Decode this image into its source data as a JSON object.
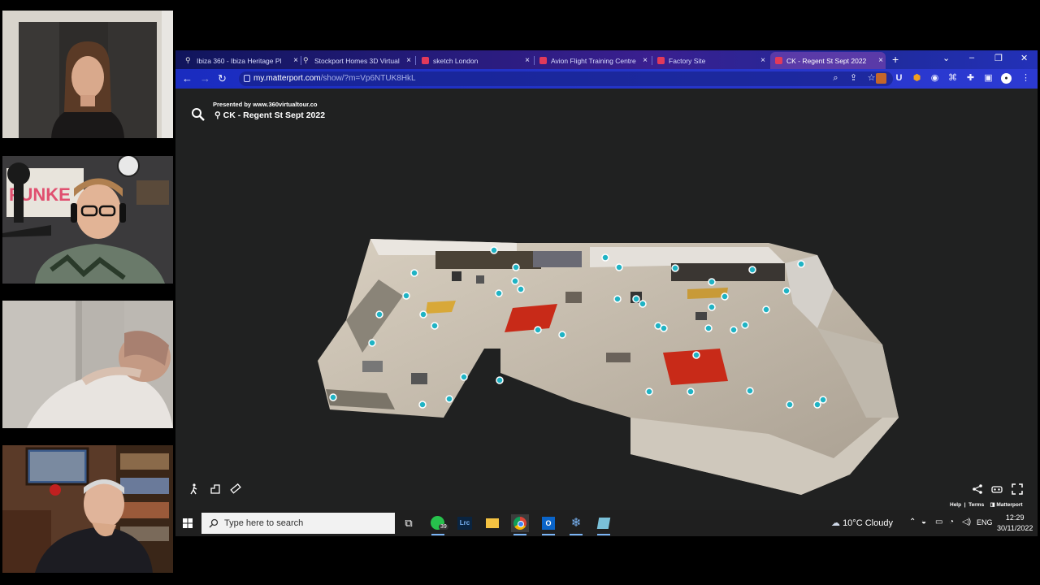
{
  "browser": {
    "tabs": [
      {
        "title": "Ibiza 360 - Ibiza Heritage Pl",
        "icon": "location-pin-icon",
        "active": false
      },
      {
        "title": "Stockport Homes 3D Virtual",
        "icon": "location-pin-icon",
        "active": false
      },
      {
        "title": "sketch London",
        "icon": "matterport-icon",
        "active": false
      },
      {
        "title": "Avion Flight Training Centre",
        "icon": "matterport-icon",
        "active": false
      },
      {
        "title": "Factory Site",
        "icon": "matterport-icon",
        "active": false
      },
      {
        "title": "CK - Regent St Sept 2022",
        "icon": "matterport-icon",
        "active": true
      }
    ],
    "url_host": "my.matterport.com",
    "url_path": "/show/?m=Vp6NTUK8HkL"
  },
  "tour": {
    "presented_by": "Presented by www.360virtualtour.co",
    "location": "CK - Regent St Sept 2022",
    "help_label": "Help",
    "terms_label": "Terms",
    "brand_label": "Matterport"
  },
  "taskbar": {
    "search_placeholder": "Type here to search",
    "whatsapp_badge": "39",
    "weather": "10°C  Cloudy",
    "language": "ENG",
    "time": "12:29",
    "date": "30/11/2022"
  },
  "colors": {
    "tab_gradient_start": "#10155c",
    "toolbar": "#2434c8",
    "viewport_bg": "#202121",
    "tag_marker": "#1fb3c4",
    "floor_red": "#c82a18"
  }
}
